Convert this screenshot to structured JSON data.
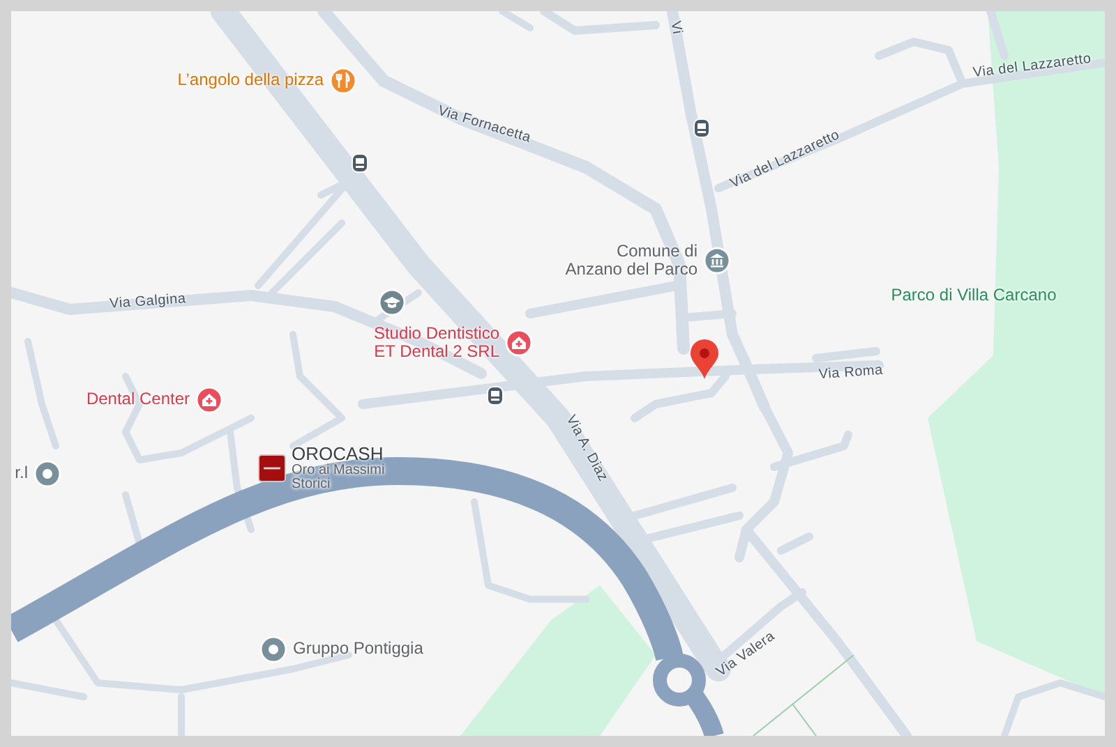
{
  "map": {
    "places": [
      {
        "kind": "restaurant",
        "name": "L’angolo della pizza"
      },
      {
        "kind": "dentist",
        "name": "Studio Dentistico\nET Dental 2 SRL"
      },
      {
        "kind": "dentist",
        "name": "Dental Center"
      },
      {
        "kind": "town_hall",
        "name": "Comune di\nAnzano del Parco"
      },
      {
        "kind": "generic",
        "name": "r.l"
      },
      {
        "kind": "business",
        "name": "OROCASH",
        "subtitle": "Oro ai Massimi\nStorici"
      },
      {
        "kind": "generic",
        "name": "Gruppo Pontiggia"
      },
      {
        "kind": "park",
        "name": "Parco di Villa Carcano"
      }
    ],
    "streets": [
      {
        "name": "Vi"
      },
      {
        "name": "Via Fornacetta"
      },
      {
        "name": "Via del Lazzaretto"
      },
      {
        "name": "Via del Lazzaretto"
      },
      {
        "name": "Via Galgina"
      },
      {
        "name": "Via A. Diaz"
      },
      {
        "name": "Via Roma"
      },
      {
        "name": "Via Valera"
      }
    ]
  }
}
